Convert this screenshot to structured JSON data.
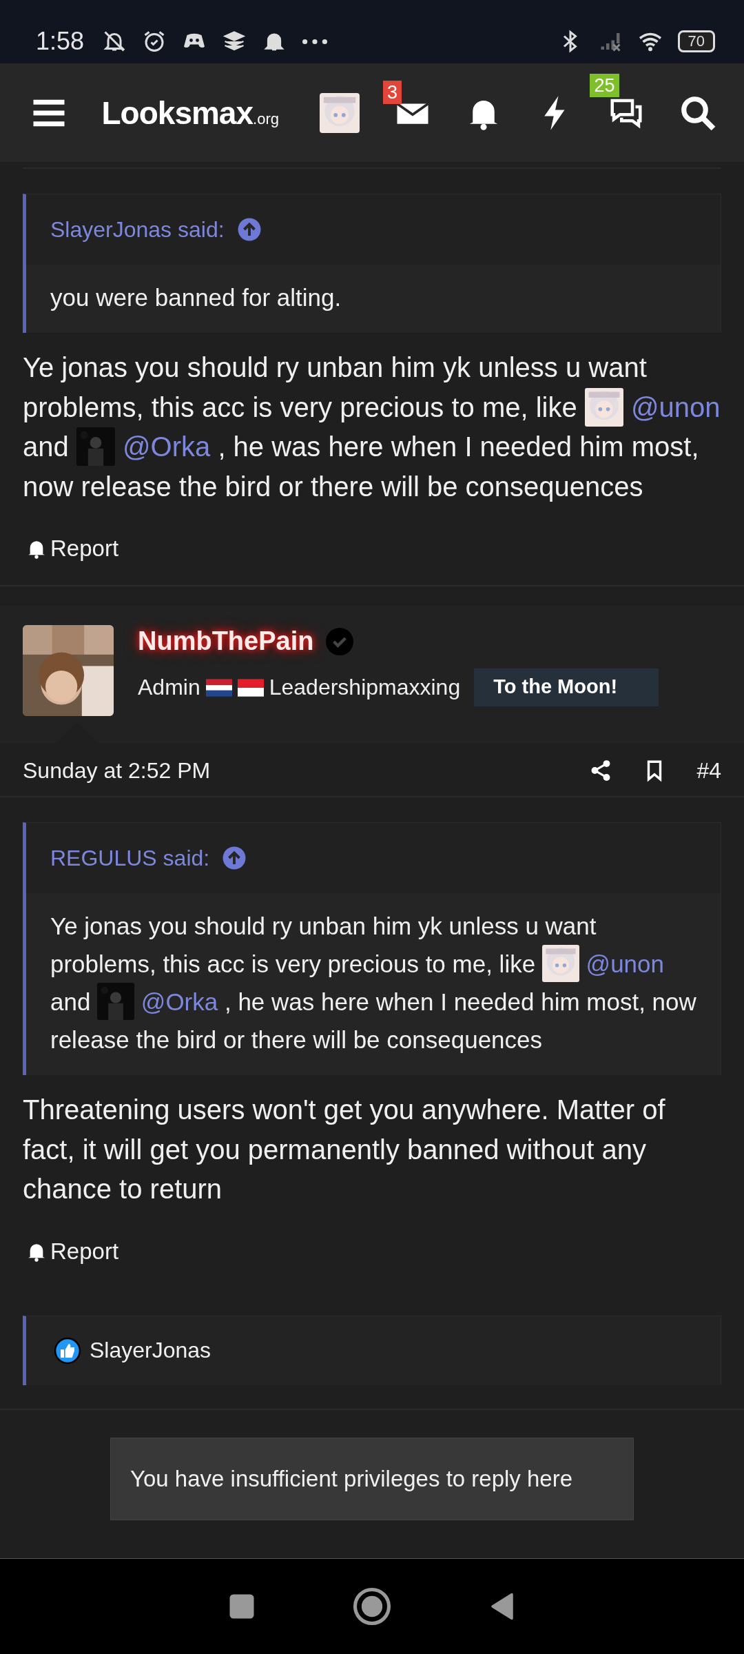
{
  "status_bar": {
    "time": "1:58",
    "battery": "70"
  },
  "header": {
    "logo": "Looksmax",
    "logo_suffix": ".org",
    "inbox_badge": "3",
    "chat_badge": "25"
  },
  "previous_post": {
    "quote": {
      "author": "SlayerJonas said:",
      "text": "you were banned for alting."
    },
    "body": [
      {
        "kind": "text",
        "text": "Ye jonas you should ry unban him yk unless u want problems, this acc is very precious to me, like "
      },
      {
        "kind": "mention",
        "text": "@unon"
      },
      {
        "kind": "text",
        "text": " and "
      },
      {
        "kind": "mention",
        "text": "@Orka"
      },
      {
        "kind": "text",
        "text": " , he was here when I needed him most, now release the bird or there will be consequences"
      }
    ],
    "report": "Report"
  },
  "post": {
    "username": "NumbThePain",
    "verified": true,
    "role": "Admin",
    "title": "Leadershipmaxxing",
    "banner": "To the Moon!",
    "date": "Sunday at 2:52 PM",
    "number": "#4",
    "quote": {
      "author": "REGULUS said:",
      "body": [
        {
          "kind": "text",
          "text": "Ye jonas you should ry unban him yk unless u want problems, this acc is very precious to me, like "
        },
        {
          "kind": "mention",
          "text": "@unon"
        },
        {
          "kind": "text",
          "text": " and "
        },
        {
          "kind": "mention",
          "text": "@Orka"
        },
        {
          "kind": "text",
          "text": " , he was here when I needed him most, now release the bird or there will be consequences"
        }
      ]
    },
    "body": "Threatening users won't get you anywhere. Matter of fact, it will get you permanently banned without any chance to return",
    "report": "Report",
    "reactions": "SlayerJonas"
  },
  "notice": "You have insufficient privileges to reply here"
}
